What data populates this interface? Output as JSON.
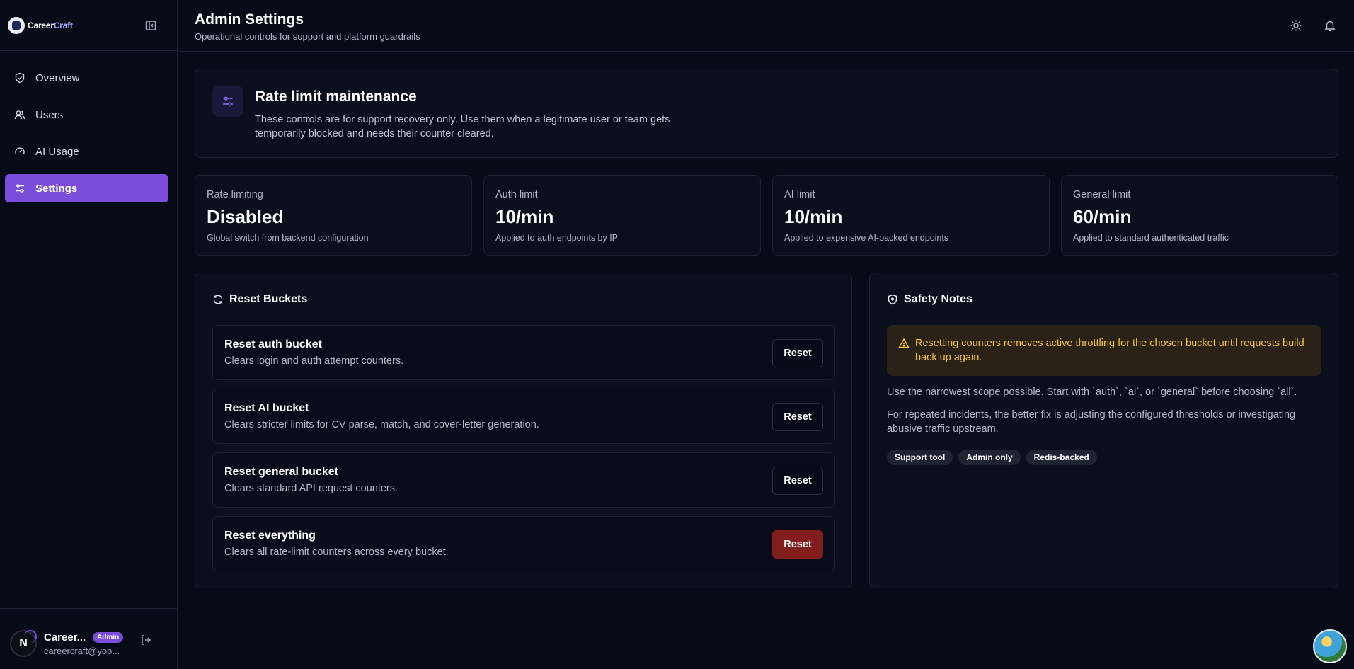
{
  "app": {
    "logo_text_main": "Career",
    "logo_text_accent": "Craft"
  },
  "sidebar": {
    "items": [
      {
        "label": "Overview",
        "icon": "shield-check-icon",
        "active": false
      },
      {
        "label": "Users",
        "icon": "users-icon",
        "active": false
      },
      {
        "label": "AI Usage",
        "icon": "gauge-icon",
        "active": false
      },
      {
        "label": "Settings",
        "icon": "sliders-icon",
        "active": true
      }
    ],
    "user": {
      "initial": "N",
      "name": "Career...",
      "badge": "Admin",
      "email": "careercraft@yop..."
    }
  },
  "header": {
    "title": "Admin Settings",
    "subtitle": "Operational controls for support and platform guardrails"
  },
  "hero": {
    "title": "Rate limit maintenance",
    "description": "These controls are for support recovery only. Use them when a legitimate user or team gets temporarily blocked and needs their counter cleared."
  },
  "stats": [
    {
      "label": "Rate limiting",
      "value": "Disabled",
      "note": "Global switch from backend configuration"
    },
    {
      "label": "Auth limit",
      "value": "10/min",
      "note": "Applied to auth endpoints by IP"
    },
    {
      "label": "AI limit",
      "value": "10/min",
      "note": "Applied to expensive AI-backed endpoints"
    },
    {
      "label": "General limit",
      "value": "60/min",
      "note": "Applied to standard authenticated traffic"
    }
  ],
  "reset_buckets": {
    "title": "Reset Buckets",
    "items": [
      {
        "title": "Reset auth bucket",
        "description": "Clears login and auth attempt counters.",
        "button": "Reset",
        "danger": false
      },
      {
        "title": "Reset AI bucket",
        "description": "Clears stricter limits for CV parse, match, and cover-letter generation.",
        "button": "Reset",
        "danger": false
      },
      {
        "title": "Reset general bucket",
        "description": "Clears standard API request counters.",
        "button": "Reset",
        "danger": false
      },
      {
        "title": "Reset everything",
        "description": "Clears all rate-limit counters across every bucket.",
        "button": "Reset",
        "danger": true
      }
    ]
  },
  "safety": {
    "title": "Safety Notes",
    "alert": "Resetting counters removes active throttling for the chosen bucket until requests build back up again.",
    "notes": [
      "Use the narrowest scope possible. Start with `auth`, `ai`, or `general` before choosing `all`.",
      "For repeated incidents, the better fix is adjusting the configured thresholds or investigating abusive traffic upstream."
    ],
    "tags": [
      "Support tool",
      "Admin only",
      "Redis-backed"
    ]
  },
  "colors": {
    "accent": "#7c4ddb",
    "danger": "#821d1d",
    "warning_text": "#f5c542",
    "background": "#070b18"
  }
}
